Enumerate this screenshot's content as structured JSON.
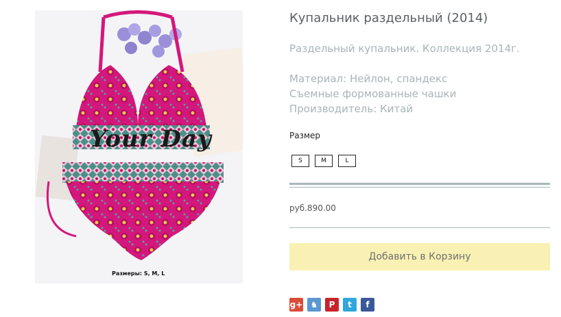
{
  "product": {
    "title": "Купальник раздельный (2014)",
    "description": [
      "Раздельный купальник. Коллекция 2014г.",
      "Материал: Нейлон, спандекс",
      "Съемные формованные чашки",
      "Производитель: Китай"
    ],
    "image": {
      "watermark_text": "Your Day",
      "caption": "Размеры: S, M, L"
    }
  },
  "options": {
    "size_label": "Размер",
    "sizes": [
      "S",
      "M",
      "L"
    ]
  },
  "price": "руб.890.00",
  "add_to_cart_label": "Добавить в Корзину",
  "social": [
    {
      "icon": "google-plus-icon",
      "glyph": "g+",
      "color": "#dc4a38"
    },
    {
      "icon": "vk-icon",
      "glyph": "♞",
      "color": "#5b97d1"
    },
    {
      "icon": "pinterest-icon",
      "glyph": "P",
      "color": "#c8232c"
    },
    {
      "icon": "twitter-icon",
      "glyph": "t",
      "color": "#2fa6de"
    },
    {
      "icon": "facebook-icon",
      "glyph": "f",
      "color": "#3b5998"
    }
  ],
  "colors": {
    "accent_rule": "#a7b8ba",
    "cart_button": "#f8f1b3",
    "swimsuit": "#d4177c"
  }
}
